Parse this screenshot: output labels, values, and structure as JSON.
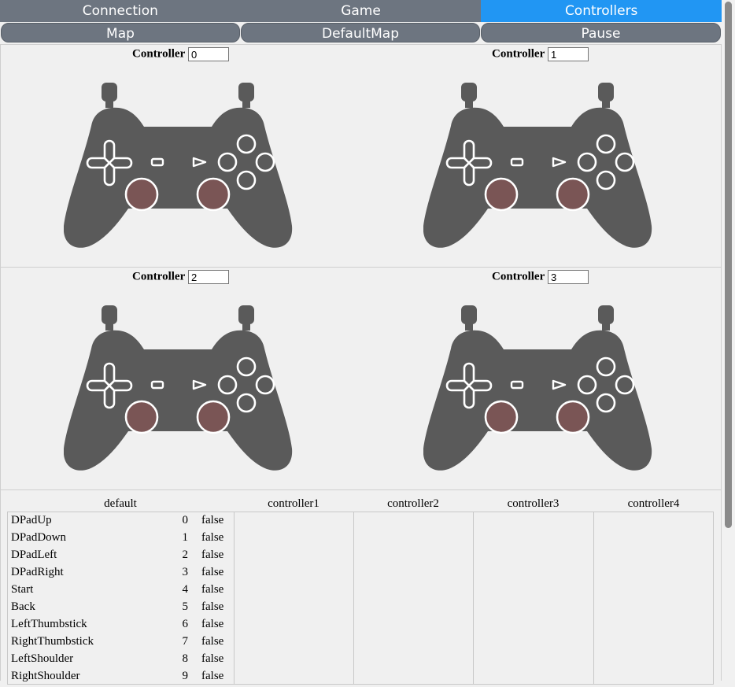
{
  "tabs": [
    {
      "label": "Connection",
      "active": false
    },
    {
      "label": "Game",
      "active": false
    },
    {
      "label": "Controllers",
      "active": true
    }
  ],
  "subbar": {
    "map": "Map",
    "default_map": "DefaultMap",
    "pause": "Pause"
  },
  "controllers": [
    {
      "label": "Controller",
      "value": "0"
    },
    {
      "label": "Controller",
      "value": "1"
    },
    {
      "label": "Controller",
      "value": "2"
    },
    {
      "label": "Controller",
      "value": "3"
    }
  ],
  "colors": {
    "tab": "#6d7580",
    "tab_active": "#2196f3",
    "pad_body": "#5a5a5a",
    "thumbstick": "#7a5555"
  },
  "mapping": {
    "columns": [
      "default",
      "controller1",
      "controller2",
      "controller3",
      "controller4"
    ],
    "rows": [
      {
        "name": "DPadUp",
        "index": "0",
        "value": "false"
      },
      {
        "name": "DPadDown",
        "index": "1",
        "value": "false"
      },
      {
        "name": "DPadLeft",
        "index": "2",
        "value": "false"
      },
      {
        "name": "DPadRight",
        "index": "3",
        "value": "false"
      },
      {
        "name": "Start",
        "index": "4",
        "value": "false"
      },
      {
        "name": "Back",
        "index": "5",
        "value": "false"
      },
      {
        "name": "LeftThumbstick",
        "index": "6",
        "value": "false"
      },
      {
        "name": "RightThumbstick",
        "index": "7",
        "value": "false"
      },
      {
        "name": "LeftShoulder",
        "index": "8",
        "value": "false"
      },
      {
        "name": "RightShoulder",
        "index": "9",
        "value": "false"
      }
    ]
  }
}
